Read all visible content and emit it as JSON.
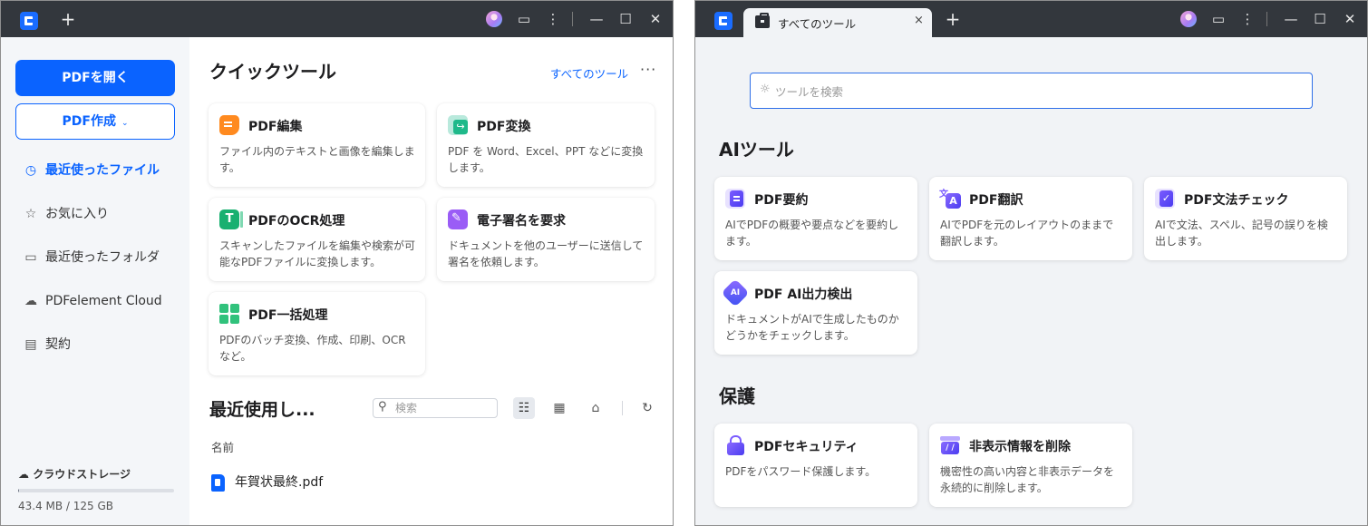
{
  "left_window": {
    "titlebar": {
      "new_tab": "+",
      "icons": [
        "avatar",
        "feedback-icon",
        "more-vertical-icon",
        "minimize-icon",
        "maximize-icon",
        "close-icon"
      ]
    },
    "sidebar": {
      "open_pdf": "PDFを開く",
      "create_pdf": "PDF作成",
      "items": [
        {
          "label": "最近使ったファイル",
          "icon": "clock-icon",
          "active": true
        },
        {
          "label": "お気に入り",
          "icon": "star-icon"
        },
        {
          "label": "最近使ったフォルダ",
          "icon": "folder-icon"
        },
        {
          "label": "PDFelement Cloud",
          "icon": "cloud-icon"
        },
        {
          "label": "契約",
          "icon": "contract-icon"
        }
      ],
      "storage": {
        "label": "クラウドストレージ",
        "usage": "43.4 MB / 125 GB",
        "fraction": 0.0003
      }
    },
    "quick_tools": {
      "title": "クイックツール",
      "all_tools_link": "すべてのツール",
      "more": "···",
      "cards": [
        {
          "title": "PDF編集",
          "desc": "ファイル内のテキストと画像を編集します。",
          "icon": "pdf-edit-icon"
        },
        {
          "title": "PDF変換",
          "desc": "PDF を Word、Excel、PPT などに変換します。",
          "icon": "pdf-convert-icon"
        },
        {
          "title": "PDFのOCR処理",
          "desc": "スキャンしたファイルを編集や検索が可能なPDFファイルに変換します。",
          "icon": "ocr-icon",
          "icon_glyph": "T"
        },
        {
          "title": "電子署名を要求",
          "desc": "ドキュメントを他のユーザーに送信して署名を依頼します。",
          "icon": "esign-icon"
        },
        {
          "title": "PDF一括処理",
          "desc": "PDFのバッチ変換、作成、印刷、OCRなど。",
          "icon": "batch-icon"
        }
      ]
    },
    "recent": {
      "title": "最近使用し...",
      "search_placeholder": "検索",
      "column_name": "名前",
      "files": [
        {
          "name": "年賀状最終.pdf"
        }
      ]
    }
  },
  "right_window": {
    "tab_title": "すべてのツール",
    "tab_close": "×",
    "new_tab": "+",
    "search_placeholder": "ツールを検索",
    "sections": [
      {
        "title": "AIツール",
        "cards": [
          {
            "title": "PDF要約",
            "desc": "AIでPDFの概要や要点などを要約します。",
            "icon": "ai-summary-icon"
          },
          {
            "title": "PDF翻訳",
            "desc": "AIでPDFを元のレイアウトのままで翻訳します。",
            "icon": "ai-translate-icon"
          },
          {
            "title": "PDF文法チェック",
            "desc": "AIで文法、スペル、記号の誤りを検出します。",
            "icon": "grammar-check-icon"
          },
          {
            "title": "PDF AI出力検出",
            "desc": "ドキュメントがAIで生成したものかどうかをチェックします。",
            "icon": "ai-detect-icon",
            "icon_glyph": "AI"
          }
        ]
      },
      {
        "title": "保護",
        "cards": [
          {
            "title": "PDFセキュリティ",
            "desc": "PDFをパスワード保護します。",
            "icon": "lock-icon"
          },
          {
            "title": "非表示情報を削除",
            "desc": "機密性の高い内容と非表示データを永続的に削除します。",
            "icon": "redact-icon"
          }
        ]
      }
    ]
  },
  "colors": {
    "accent": "#0a63ff",
    "titlebar": "#33373d",
    "sidebar_bg": "#f4f6f9",
    "tools_bg": "#f1f3f6"
  }
}
